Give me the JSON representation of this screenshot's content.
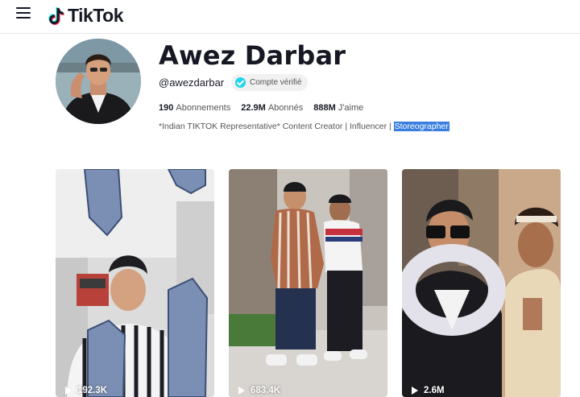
{
  "brand": {
    "name": "TikTok"
  },
  "profile": {
    "name": "Awez Darbar",
    "handle": "@awezdarbar",
    "verified_label": "Compte vérifié",
    "stats": [
      {
        "value": "190",
        "label": "Abonnements"
      },
      {
        "value": "22.9M",
        "label": "Abonnés"
      },
      {
        "value": "888M",
        "label": "J'aime"
      }
    ],
    "bio": "*Indian TIKTOK Representative* Content Creator | Influencer | ",
    "bio_highlight": "Storeographer"
  },
  "videos": [
    {
      "views": "192.3K"
    },
    {
      "views": "683.4K"
    },
    {
      "views": "2.6M"
    }
  ],
  "colors": {
    "accent": "#20d5ec",
    "text": "#161823",
    "muted": "#555555",
    "highlight": "#3a7fe0"
  }
}
